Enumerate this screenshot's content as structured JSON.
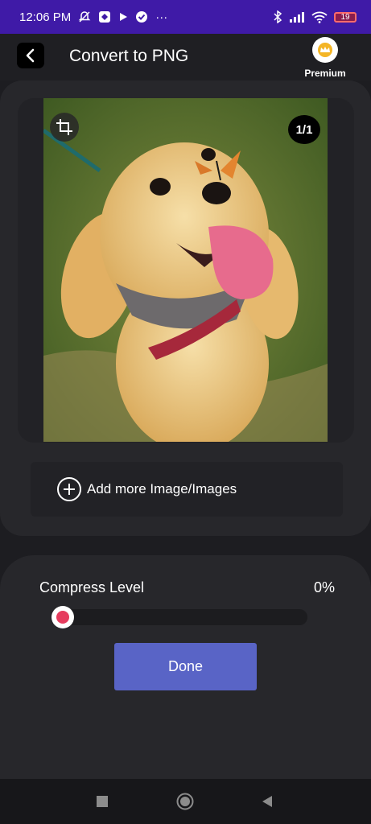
{
  "status_bar": {
    "time": "12:06 PM",
    "more": "···",
    "battery": "19"
  },
  "header": {
    "title": "Convert to PNG",
    "premium_label": "Premium"
  },
  "image_card": {
    "page_counter": "1/1",
    "add_more_label": "Add more Image/Images"
  },
  "compress": {
    "label": "Compress Level",
    "value": "0%",
    "level": 0,
    "done_label": "Done"
  },
  "colors": {
    "status_bar": "#3f1aa7",
    "accent_button": "#5964c6",
    "slider_thumb_dot": "#e63c5e"
  }
}
